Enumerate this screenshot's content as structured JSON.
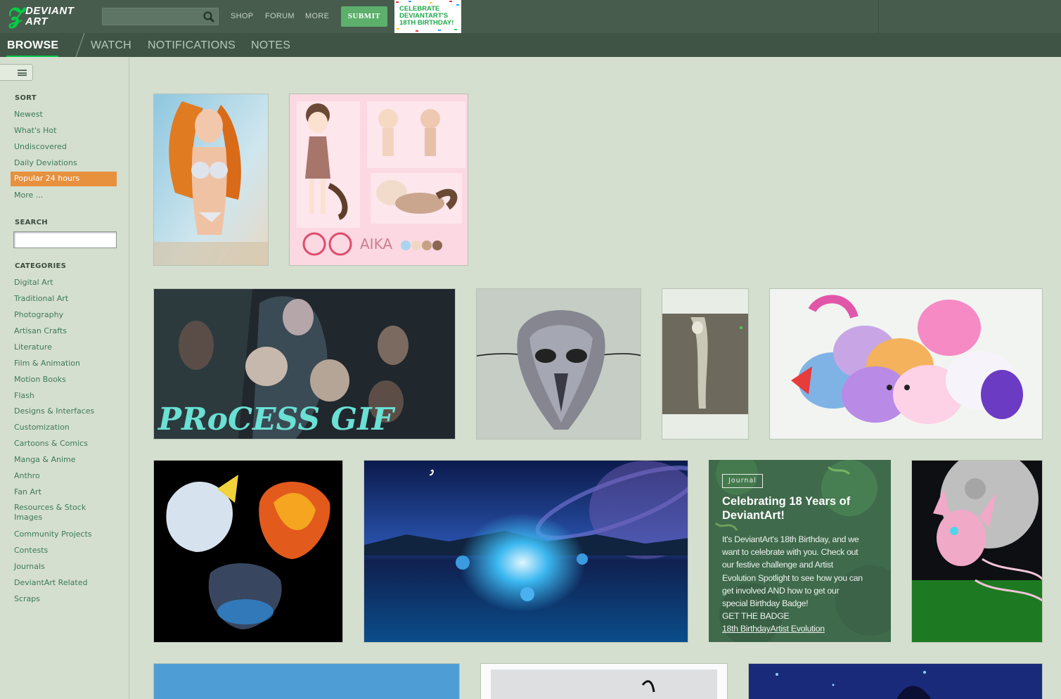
{
  "header": {
    "logo_line1": "DEVIANT",
    "logo_line2": "ART",
    "search_value": "",
    "nav": [
      "SHOP",
      "FORUM",
      "MORE"
    ],
    "submit_label": "SUBMIT",
    "birthday_banner": [
      "CELEBRATE",
      "DEVIANTART'S",
      "18TH BIRTHDAY!"
    ]
  },
  "subnav": {
    "tabs": [
      "BROWSE",
      "WATCH",
      "NOTIFICATIONS",
      "NOTES"
    ],
    "active": "BROWSE"
  },
  "sidebar": {
    "sort_heading": "SORT",
    "sort_items": [
      "Newest",
      "What's Hot",
      "Undiscovered",
      "Daily Deviations",
      "Popular 24 hours",
      "More ..."
    ],
    "sort_selected": "Popular 24 hours",
    "search_heading": "SEARCH",
    "search_value": "",
    "categories_heading": "CATEGORIES",
    "categories": [
      "Digital Art",
      "Traditional Art",
      "Photography",
      "Artisan Crafts",
      "Literature",
      "Film & Animation",
      "Motion Books",
      "Flash",
      "Designs & Interfaces",
      "Customization",
      "Cartoons & Comics",
      "Manga & Anime",
      "Anthro",
      "Fan Art",
      "Resources & Stock Images",
      "Community Projects",
      "Contests",
      "Journals",
      "DeviantArt Related",
      "Scraps"
    ]
  },
  "gallery": {
    "thumbnails": [
      {
        "name": "beach-redhead-painting"
      },
      {
        "name": "aika-character-sheet",
        "caption": "AIKA"
      },
      {
        "name": "process-gif-skulls",
        "caption": "PRoCESS GIF"
      },
      {
        "name": "feather-mask"
      },
      {
        "name": "dancer-photo"
      },
      {
        "name": "pony-blobs"
      },
      {
        "name": "dragon-trio"
      },
      {
        "name": "blue-fantasy-landscape"
      },
      {
        "name": "sylveon-moon"
      },
      {
        "name": "sky-bottom-1"
      },
      {
        "name": "white-sculpture-bottom"
      },
      {
        "name": "dark-blue-bottom"
      }
    ],
    "journal": {
      "badge": "Journal",
      "title": "Celebrating 18 Years of DeviantArt!",
      "body_lines": [
        "It's DeviantArt's 18th Birthday, and we",
        "want to celebrate with you. Check out",
        "our festive challenge and Artist",
        "Evolution Spotlight to see how you can",
        "get involved AND how to get our",
        "special Birthday Badge!"
      ],
      "cta": "GET THE BADGE",
      "links": "18th BirthdayArtist Evolution"
    }
  },
  "colors": {
    "topbar": "#475c4d",
    "subnav": "#3f5445",
    "page_bg": "#d5dfcf",
    "accent_green": "#05cc47",
    "submit_green": "#5cb06b",
    "sort_selected": "#e7913f",
    "link": "#3b7a57"
  }
}
